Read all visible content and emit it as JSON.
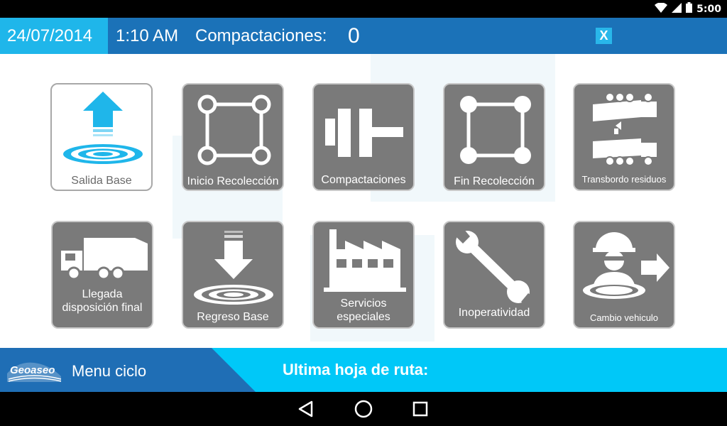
{
  "status_bar": {
    "time": "5:00",
    "icons": [
      "wifi-icon",
      "signal-icon",
      "battery-icon"
    ]
  },
  "header": {
    "date": "24/07/2014",
    "time": "1:10 AM",
    "compactions_label": "Compactaciones:",
    "compactions_value": "0",
    "close_label": "X"
  },
  "tiles": [
    {
      "label": "Salida Base",
      "icon": "departure-base-icon"
    },
    {
      "label": "Inicio Recolección",
      "icon": "collection-start-icon"
    },
    {
      "label": "Compactaciones",
      "icon": "compaction-icon"
    },
    {
      "label": "Fin Recolección",
      "icon": "collection-end-icon"
    },
    {
      "label": "Transbordo residuos",
      "icon": "waste-transfer-icon"
    },
    {
      "label": "Llegada disposición final",
      "icon": "garbage-truck-icon"
    },
    {
      "label": "Regreso Base",
      "icon": "return-base-icon"
    },
    {
      "label": "Servicios especiales",
      "icon": "factory-icon"
    },
    {
      "label": "Inoperatividad",
      "icon": "wrench-icon"
    },
    {
      "label": "Cambio vehiculo",
      "icon": "driver-change-icon"
    }
  ],
  "footer": {
    "logo_text": "Geoaseo",
    "menu_title": "Menu ciclo",
    "route_label": "Ultima hoja de ruta:"
  },
  "navbar": {
    "buttons": [
      "back-icon",
      "home-icon",
      "recents-icon"
    ]
  },
  "colors": {
    "header_blue": "#1b72b8",
    "accent_cyan": "#1fb6ea",
    "tile_gray": "#7a7a7a",
    "footer_cyan": "#00c8f8"
  }
}
